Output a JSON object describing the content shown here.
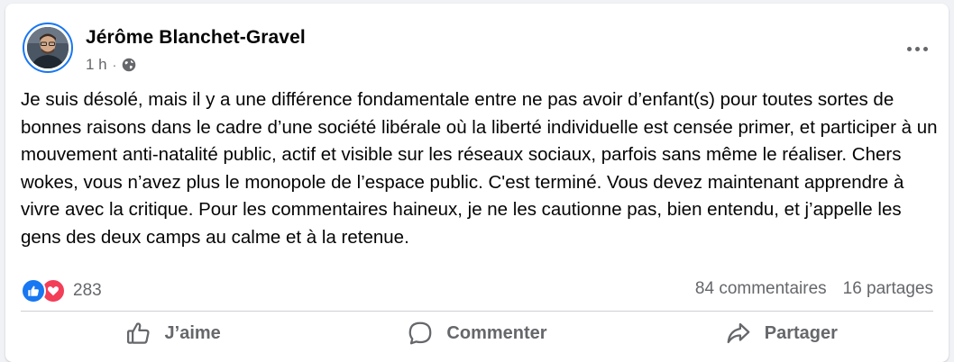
{
  "post": {
    "author": "Jérôme Blanchet-Gravel",
    "time": "1 h",
    "separator": "·",
    "privacy_icon": "globe-icon",
    "text": "Je suis désolé, mais il y a une différence fondamentale entre ne pas avoir d’enfant(s) pour toutes sortes de bonnes raisons dans le cadre d’une société libérale où la liberté individuelle est censée primer, et participer à un mouvement anti-natalité public, actif et visible sur les réseaux sociaux, parfois sans même le réaliser. Chers wokes, vous n’avez plus le monopole de l’espace public. C'est terminé. Vous devez maintenant apprendre à vivre avec la critique. Pour les commentaires haineux, je ne les cautionne pas, bien entendu, et j’appelle les gens des deux camps au calme et à la retenue."
  },
  "stats": {
    "reaction_icons": [
      "like-icon",
      "love-icon"
    ],
    "reaction_count": "283",
    "comments": "84 commentaires",
    "shares": "16 partages"
  },
  "actions": {
    "like": "J’aime",
    "comment": "Commenter",
    "share": "Partager"
  },
  "colors": {
    "brand_blue": "#1877f2",
    "love_red": "#f33e58",
    "secondary_text": "#65676b",
    "primary_text": "#050505"
  }
}
